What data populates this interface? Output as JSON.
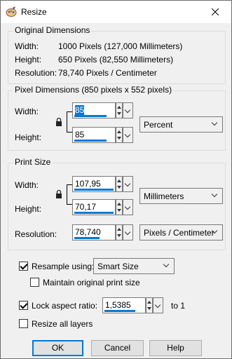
{
  "window": {
    "title": "Resize"
  },
  "original": {
    "title": "Original Dimensions",
    "rows": [
      {
        "label": "Width:",
        "value": "1000 Pixels (127,000 Millimeters)"
      },
      {
        "label": "Height:",
        "value": "650 Pixels (82,550 Millimeters)"
      },
      {
        "label": "Resolution:",
        "value": "78,740 Pixels / Centimeter"
      }
    ]
  },
  "pixel": {
    "title": "Pixel Dimensions (850 pixels x 552 pixels)",
    "width_label": "Width:",
    "height_label": "Height:",
    "width_value": "85",
    "height_value": "85",
    "unit": "Percent"
  },
  "print": {
    "title": "Print Size",
    "width_label": "Width:",
    "height_label": "Height:",
    "resolution_label": "Resolution:",
    "width_value": "107,95",
    "height_value": "70,17",
    "resolution_value": "78,740",
    "unit": "Millimeters",
    "resolution_unit": "Pixels / Centimeter"
  },
  "options": {
    "resample_label": "Resample using:",
    "resample_checked": true,
    "resample_method": "Smart Size",
    "maintain_label": "Maintain original print size",
    "maintain_checked": false,
    "lock_label": "Lock aspect ratio:",
    "lock_checked": true,
    "ratio_value": "1,5385",
    "ratio_suffix": "to 1",
    "resize_layers_label": "Resize all layers",
    "resize_layers_checked": false
  },
  "buttons": {
    "ok": "OK",
    "cancel": "Cancel",
    "help": "Help"
  },
  "colors": {
    "accent": "#0078d7",
    "window_bg": "#f0f0f0"
  },
  "icons": {
    "app": "paintshop-palette-icon",
    "close": "close-icon",
    "lock": "padlock-icon"
  }
}
